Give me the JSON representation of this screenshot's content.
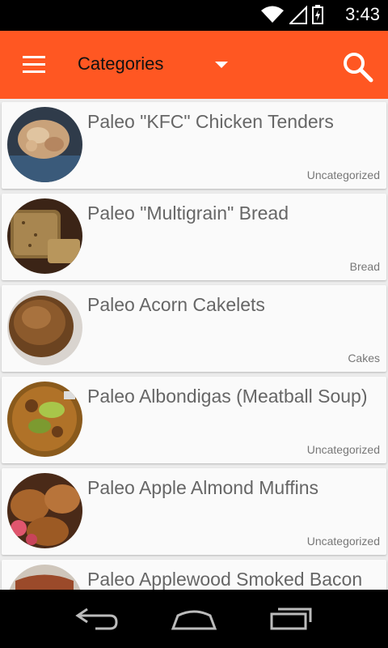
{
  "status_bar": {
    "time": "3:43"
  },
  "app_bar": {
    "title": "Categories"
  },
  "recipes": [
    {
      "title": "Paleo \"KFC\" Chicken Tenders",
      "category": "Uncategorized",
      "image": "fried-chicken-photo"
    },
    {
      "title": "Paleo \"Multigrain\" Bread",
      "category": "Bread",
      "image": "bread-loaf-photo"
    },
    {
      "title": "Paleo Acorn Cakelets",
      "category": "Cakes",
      "image": "cakelet-photo"
    },
    {
      "title": "Paleo Albondigas (Meatball Soup)",
      "category": "Uncategorized",
      "image": "meatball-soup-photo"
    },
    {
      "title": "Paleo Apple Almond Muffins",
      "category": "Uncategorized",
      "image": "muffins-photo"
    },
    {
      "title": "Paleo Applewood Smoked Bacon",
      "category": "",
      "image": "bacon-photo"
    }
  ],
  "colors": {
    "accent": "#ff5722",
    "card": "#fafafa",
    "background": "#ececec"
  }
}
